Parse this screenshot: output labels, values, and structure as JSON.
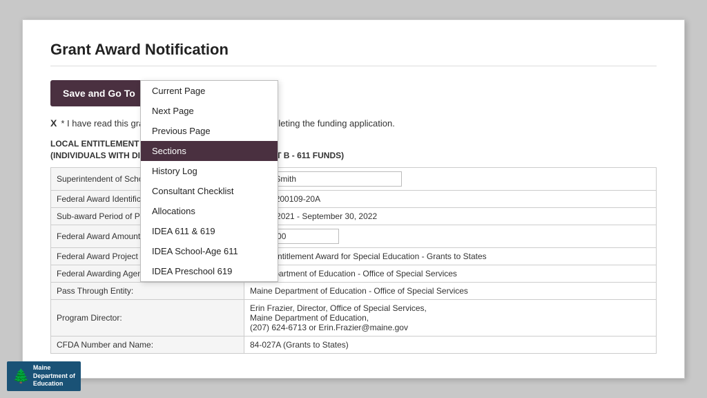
{
  "page": {
    "title": "Grant Award Notification"
  },
  "toolbar": {
    "save_go_to_label": "Save and Go To"
  },
  "dropdown": {
    "items": [
      {
        "label": "Current Page",
        "active": false
      },
      {
        "label": "Next Page",
        "active": false
      },
      {
        "label": "Previous Page",
        "active": false
      },
      {
        "label": "Sections",
        "active": true
      },
      {
        "label": "History Log",
        "active": false
      },
      {
        "label": "Consultant Checklist",
        "active": false
      },
      {
        "label": "Allocations",
        "active": false
      },
      {
        "label": "IDEA 611 & 619",
        "active": false
      },
      {
        "label": "IDEA School-Age 611",
        "active": false
      },
      {
        "label": "IDEA Preschool 619",
        "active": false
      }
    ]
  },
  "read_confirm": {
    "checkbox": "X",
    "text": "* I have read this grant award notification prior to completing the funding application."
  },
  "section_title_line1": "LOCAL ENTITLEMENT AWARD - SCHOOL AGE FUNDS",
  "section_title_line2": "(INDIVIDUALS WITH DISABILITIES EDUCATION ACT, PART B - 611 FUNDS)",
  "form_rows": [
    {
      "label": "Superintendent of School:",
      "value": "",
      "type": "text_input",
      "input_value": "John Smith"
    },
    {
      "label": "Federal Award Identification Number:",
      "value": "H027A200109-20A",
      "type": "text"
    },
    {
      "label": "Sub-award Period of Performance:",
      "value": "July 1, 2021 - September 30, 2022",
      "type": "text"
    },
    {
      "label": "Federal Award Amount:",
      "value": "100.00",
      "type": "dollar",
      "dollar_sign": "$"
    },
    {
      "label": "Federal Award Project Description:",
      "value": "Local Entitlement Award for Special Education - Grants to States",
      "type": "text"
    },
    {
      "label": "Federal Awarding Agency:",
      "value": "US Department of Education - Office of Special Services",
      "type": "text"
    },
    {
      "label": "Pass Through Entity:",
      "value": "Maine Department of Education - Office of Special Services",
      "type": "text"
    },
    {
      "label": "Program Director:",
      "value": "Erin Frazier, Director, Office of Special Services,\nMaine Department of Education,\n(207) 624-6713 or Erin.Frazier@maine.gov",
      "type": "text"
    },
    {
      "label": "CFDA Number and Name:",
      "value": "84-027A (Grants to States)",
      "type": "text"
    }
  ],
  "footer": {
    "logo_line1": "Maine",
    "logo_line2": "Department of",
    "logo_line3": "Education"
  }
}
